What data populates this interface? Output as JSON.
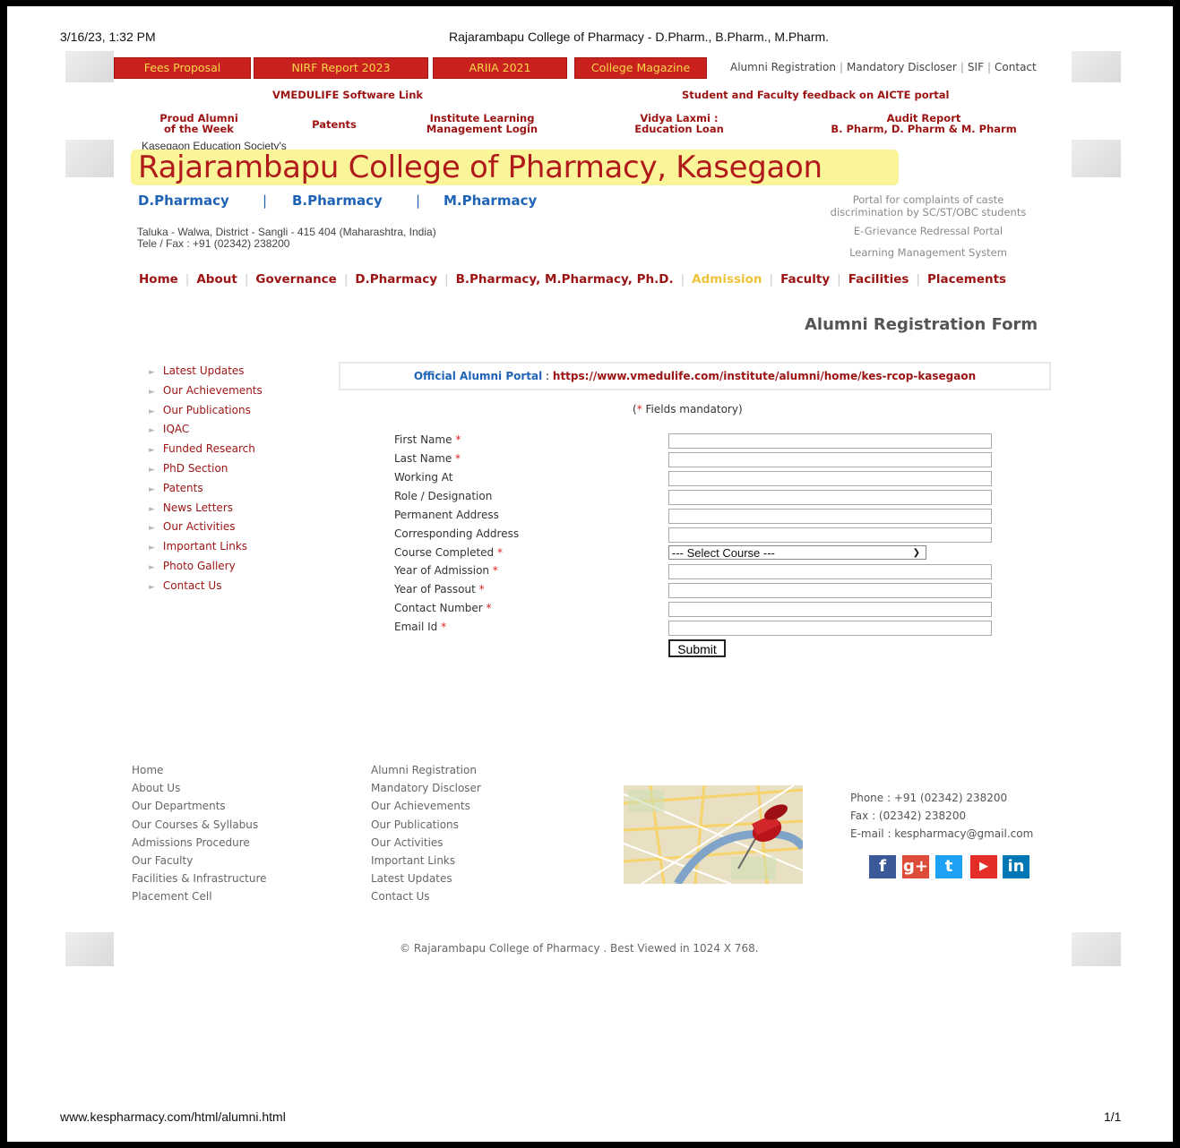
{
  "print_header": {
    "datetime": "3/16/23, 1:32 PM",
    "doc_title": "Rajarambapu College of Pharmacy - D.Pharm., B.Pharm., M.Pharm."
  },
  "print_footer": {
    "url": "www.kespharmacy.com/html/alumni.html",
    "page": "1/1"
  },
  "top_buttons": [
    "Fees Proposal",
    "NIRF Report 2023",
    "ARIIA 2021",
    "College Magazine"
  ],
  "top_links": [
    "Alumni Registration",
    "Mandatory Discloser",
    "SIF",
    "Contact"
  ],
  "links_row1": {
    "vmedulife": "VMEDULIFE Software Link",
    "feedback": "Student and Faculty feedback on AICTE portal"
  },
  "links_row2": {
    "alumni_l1": "Proud Alumni",
    "alumni_l2": "of the Week",
    "patents": "Patents",
    "lms_l1": "Institute Learning",
    "lms_l2": "Management Login",
    "loan_l1": "Vidya Laxmi :",
    "loan_l2": "Education Loan",
    "audit_l1": "Audit Report",
    "audit_l2": "B. Pharm, D. Pharm & M. Pharm"
  },
  "society": "Kasegaon Education Society's",
  "college_name": "Rajarambapu College of Pharmacy, Kasegaon",
  "programs": [
    "D.Pharmacy",
    "B.Pharmacy",
    "M.Pharmacy"
  ],
  "address": {
    "line1": "Taluka - Walwa, District - Sangli - 415 404 (Maharashtra, India)",
    "line2": "Tele / Fax : +91 (02342) 238200"
  },
  "right_links": {
    "caste_l1": "Portal for complaints of caste",
    "caste_l2": "discrimination by SC/ST/OBC students",
    "grievance": "E-Grievance Redressal Portal",
    "lms": "Learning Management System"
  },
  "main_nav": [
    "Home",
    "About",
    "Governance",
    "D.Pharmacy",
    "B.Pharmacy, M.Pharmacy, Ph.D.",
    "Admission",
    "Faculty",
    "Facilities",
    "Placements"
  ],
  "active_nav": "Admission",
  "form_title": "Alumni Registration Form",
  "sidebar": [
    "Latest Updates",
    "Our Achievements",
    "Our Publications",
    "IQAC",
    "Funded Research",
    "PhD Section",
    "Patents",
    "News Letters",
    "Our Activities",
    "Important Links",
    "Photo Gallery",
    "Contact Us"
  ],
  "portal": {
    "label": "Official Alumni Portal",
    "colon": " : ",
    "url": "https://www.vmedulife.com/institute/alumni/home/kes-rcop-kasegaon"
  },
  "mandatory_note": {
    "open": "(",
    "star": "*",
    "text": " Fields mandatory)"
  },
  "form": {
    "fields": [
      {
        "label": "First Name",
        "required": "*",
        "value": ""
      },
      {
        "label": "Last Name",
        "required": "*",
        "value": ""
      },
      {
        "label": "Working At",
        "required": "",
        "value": ""
      },
      {
        "label": "Role / Designation",
        "required": "",
        "value": ""
      },
      {
        "label": "Permanent Address",
        "required": "",
        "value": ""
      },
      {
        "label": "Corresponding Address",
        "required": "",
        "value": ""
      },
      {
        "label": "Course Completed",
        "required": "*",
        "value": "--- Select Course ---"
      },
      {
        "label": "Year of Admission",
        "required": "*",
        "value": ""
      },
      {
        "label": "Year of Passout",
        "required": "*",
        "value": ""
      },
      {
        "label": "Contact Number",
        "required": "*",
        "value": ""
      },
      {
        "label": "Email Id",
        "required": "*",
        "value": ""
      }
    ],
    "submit": "Submit"
  },
  "footer_col1": [
    "Home",
    "About Us",
    "Our Departments",
    "Our Courses & Syllabus",
    "Admissions Procedure",
    "Our Faculty",
    "Facilities & Infrastructure",
    "Placement Cell"
  ],
  "footer_col2": [
    "Alumni Registration",
    "Mandatory Discloser",
    "Our Achievements",
    "Our Publications",
    "Our Activities",
    "Important Links",
    "Latest Updates",
    "Contact Us"
  ],
  "footer_contact": {
    "phone": "Phone : +91 (02342) 238200",
    "fax": "Fax : (02342) 238200",
    "email": "E-mail : kespharmacy@gmail.com"
  },
  "social_icons": [
    "facebook-icon",
    "google-plus-icon",
    "twitter-icon",
    "youtube-icon",
    "linkedin-icon"
  ],
  "social_glyphs": [
    "f",
    "g+",
    "t",
    "▶",
    "in"
  ],
  "social_colors": [
    "#3b5998",
    "#dd4b39",
    "#1da1f2",
    "#e52d27",
    "#0077b5"
  ],
  "copyright": "© Rajarambapu College of Pharmacy . Best Viewed in 1024 X 768."
}
